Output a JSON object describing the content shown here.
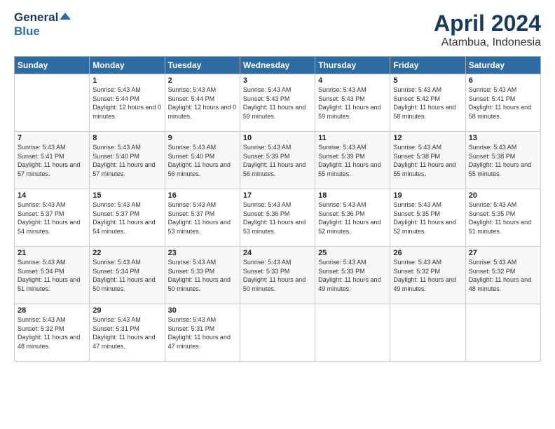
{
  "header": {
    "logo_line1": "General",
    "logo_line2": "Blue",
    "month": "April 2024",
    "location": "Atambua, Indonesia"
  },
  "days_of_week": [
    "Sunday",
    "Monday",
    "Tuesday",
    "Wednesday",
    "Thursday",
    "Friday",
    "Saturday"
  ],
  "weeks": [
    [
      {
        "day": "",
        "sunrise": "",
        "sunset": "",
        "daylight": ""
      },
      {
        "day": "1",
        "sunrise": "Sunrise: 5:43 AM",
        "sunset": "Sunset: 5:44 PM",
        "daylight": "Daylight: 12 hours and 0 minutes."
      },
      {
        "day": "2",
        "sunrise": "Sunrise: 5:43 AM",
        "sunset": "Sunset: 5:44 PM",
        "daylight": "Daylight: 12 hours and 0 minutes."
      },
      {
        "day": "3",
        "sunrise": "Sunrise: 5:43 AM",
        "sunset": "Sunset: 5:43 PM",
        "daylight": "Daylight: 11 hours and 59 minutes."
      },
      {
        "day": "4",
        "sunrise": "Sunrise: 5:43 AM",
        "sunset": "Sunset: 5:43 PM",
        "daylight": "Daylight: 11 hours and 59 minutes."
      },
      {
        "day": "5",
        "sunrise": "Sunrise: 5:43 AM",
        "sunset": "Sunset: 5:42 PM",
        "daylight": "Daylight: 11 hours and 58 minutes."
      },
      {
        "day": "6",
        "sunrise": "Sunrise: 5:43 AM",
        "sunset": "Sunset: 5:41 PM",
        "daylight": "Daylight: 11 hours and 58 minutes."
      }
    ],
    [
      {
        "day": "7",
        "sunrise": "Sunrise: 5:43 AM",
        "sunset": "Sunset: 5:41 PM",
        "daylight": "Daylight: 11 hours and 57 minutes."
      },
      {
        "day": "8",
        "sunrise": "Sunrise: 5:43 AM",
        "sunset": "Sunset: 5:40 PM",
        "daylight": "Daylight: 11 hours and 57 minutes."
      },
      {
        "day": "9",
        "sunrise": "Sunrise: 5:43 AM",
        "sunset": "Sunset: 5:40 PM",
        "daylight": "Daylight: 11 hours and 56 minutes."
      },
      {
        "day": "10",
        "sunrise": "Sunrise: 5:43 AM",
        "sunset": "Sunset: 5:39 PM",
        "daylight": "Daylight: 11 hours and 56 minutes."
      },
      {
        "day": "11",
        "sunrise": "Sunrise: 5:43 AM",
        "sunset": "Sunset: 5:39 PM",
        "daylight": "Daylight: 11 hours and 55 minutes."
      },
      {
        "day": "12",
        "sunrise": "Sunrise: 5:43 AM",
        "sunset": "Sunset: 5:38 PM",
        "daylight": "Daylight: 11 hours and 55 minutes."
      },
      {
        "day": "13",
        "sunrise": "Sunrise: 5:43 AM",
        "sunset": "Sunset: 5:38 PM",
        "daylight": "Daylight: 11 hours and 55 minutes."
      }
    ],
    [
      {
        "day": "14",
        "sunrise": "Sunrise: 5:43 AM",
        "sunset": "Sunset: 5:37 PM",
        "daylight": "Daylight: 11 hours and 54 minutes."
      },
      {
        "day": "15",
        "sunrise": "Sunrise: 5:43 AM",
        "sunset": "Sunset: 5:37 PM",
        "daylight": "Daylight: 11 hours and 54 minutes."
      },
      {
        "day": "16",
        "sunrise": "Sunrise: 5:43 AM",
        "sunset": "Sunset: 5:37 PM",
        "daylight": "Daylight: 11 hours and 53 minutes."
      },
      {
        "day": "17",
        "sunrise": "Sunrise: 5:43 AM",
        "sunset": "Sunset: 5:36 PM",
        "daylight": "Daylight: 11 hours and 53 minutes."
      },
      {
        "day": "18",
        "sunrise": "Sunrise: 5:43 AM",
        "sunset": "Sunset: 5:36 PM",
        "daylight": "Daylight: 11 hours and 52 minutes."
      },
      {
        "day": "19",
        "sunrise": "Sunrise: 5:43 AM",
        "sunset": "Sunset: 5:35 PM",
        "daylight": "Daylight: 11 hours and 52 minutes."
      },
      {
        "day": "20",
        "sunrise": "Sunrise: 5:43 AM",
        "sunset": "Sunset: 5:35 PM",
        "daylight": "Daylight: 11 hours and 51 minutes."
      }
    ],
    [
      {
        "day": "21",
        "sunrise": "Sunrise: 5:43 AM",
        "sunset": "Sunset: 5:34 PM",
        "daylight": "Daylight: 11 hours and 51 minutes."
      },
      {
        "day": "22",
        "sunrise": "Sunrise: 5:43 AM",
        "sunset": "Sunset: 5:34 PM",
        "daylight": "Daylight: 11 hours and 50 minutes."
      },
      {
        "day": "23",
        "sunrise": "Sunrise: 5:43 AM",
        "sunset": "Sunset: 5:33 PM",
        "daylight": "Daylight: 11 hours and 50 minutes."
      },
      {
        "day": "24",
        "sunrise": "Sunrise: 5:43 AM",
        "sunset": "Sunset: 5:33 PM",
        "daylight": "Daylight: 11 hours and 50 minutes."
      },
      {
        "day": "25",
        "sunrise": "Sunrise: 5:43 AM",
        "sunset": "Sunset: 5:33 PM",
        "daylight": "Daylight: 11 hours and 49 minutes."
      },
      {
        "day": "26",
        "sunrise": "Sunrise: 5:43 AM",
        "sunset": "Sunset: 5:32 PM",
        "daylight": "Daylight: 11 hours and 49 minutes."
      },
      {
        "day": "27",
        "sunrise": "Sunrise: 5:43 AM",
        "sunset": "Sunset: 5:32 PM",
        "daylight": "Daylight: 11 hours and 48 minutes."
      }
    ],
    [
      {
        "day": "28",
        "sunrise": "Sunrise: 5:43 AM",
        "sunset": "Sunset: 5:32 PM",
        "daylight": "Daylight: 11 hours and 48 minutes."
      },
      {
        "day": "29",
        "sunrise": "Sunrise: 5:43 AM",
        "sunset": "Sunset: 5:31 PM",
        "daylight": "Daylight: 11 hours and 47 minutes."
      },
      {
        "day": "30",
        "sunrise": "Sunrise: 5:43 AM",
        "sunset": "Sunset: 5:31 PM",
        "daylight": "Daylight: 11 hours and 47 minutes."
      },
      {
        "day": "",
        "sunrise": "",
        "sunset": "",
        "daylight": ""
      },
      {
        "day": "",
        "sunrise": "",
        "sunset": "",
        "daylight": ""
      },
      {
        "day": "",
        "sunrise": "",
        "sunset": "",
        "daylight": ""
      },
      {
        "day": "",
        "sunrise": "",
        "sunset": "",
        "daylight": ""
      }
    ]
  ]
}
